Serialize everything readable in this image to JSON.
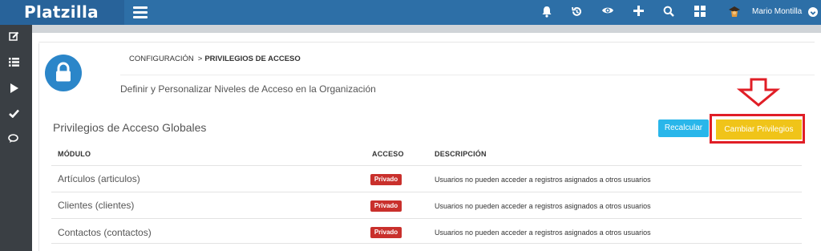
{
  "app": {
    "brand": "Platzilla"
  },
  "topbar": {
    "icons": [
      "bell-icon",
      "history-icon",
      "eye-icon",
      "plus-icon",
      "search-icon",
      "grid-icon"
    ],
    "user_name": "Mario Montilla"
  },
  "sidebar": {
    "items": [
      "edit-icon",
      "list-icon",
      "play-icon",
      "check-icon",
      "chat-icon"
    ]
  },
  "breadcrumb": {
    "parent": "CONFIGURACIÓN",
    "separator": ">",
    "current": "PRIVILEGIOS DE ACCESO"
  },
  "page": {
    "subtitle": "Definir y Personalizar Niveles de Acceso en la Organización",
    "section_title": "Privilegios de Acceso Globales"
  },
  "buttons": {
    "recalcular": "Recalcular",
    "cambiar": "Cambiar Privilegios"
  },
  "table": {
    "headers": {
      "modulo": "MÓDULO",
      "acceso": "ACCESO",
      "descripcion": "DESCRIPCIÓN"
    },
    "rows": [
      {
        "modulo": "Artículos (articulos)",
        "acceso": "Privado",
        "descripcion": "Usuarios no pueden acceder a registros asignados a otros usuarios"
      },
      {
        "modulo": "Clientes (clientes)",
        "acceso": "Privado",
        "descripcion": "Usuarios no pueden acceder a registros asignados a otros usuarios"
      },
      {
        "modulo": "Contactos (contactos)",
        "acceso": "Privado",
        "descripcion": "Usuarios no pueden acceder a registros asignados a otros usuarios"
      }
    ]
  },
  "colors": {
    "topbar": "#2d6fa7",
    "sidebar": "#3a3f44",
    "recalcular": "#29b6ea",
    "cambiar": "#f0c419",
    "badge": "#c9302c",
    "highlight": "#e01e26"
  }
}
